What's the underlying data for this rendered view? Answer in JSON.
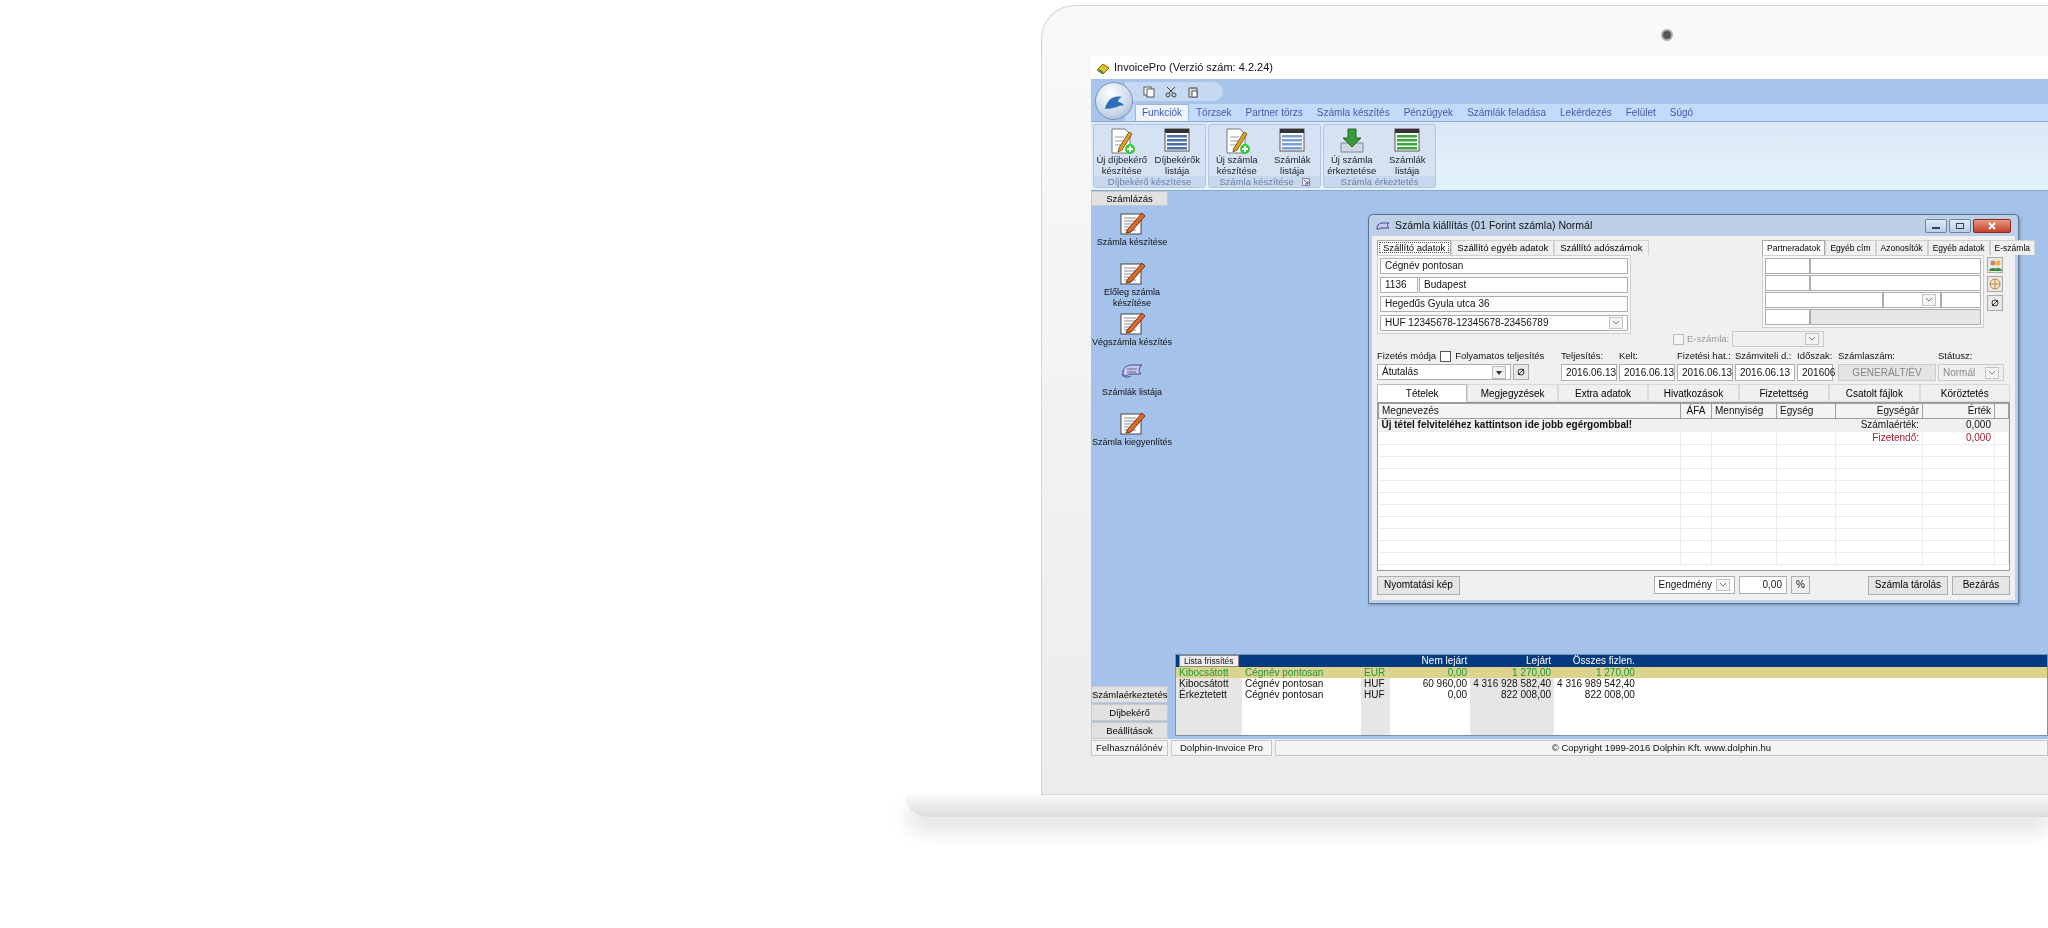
{
  "window": {
    "title": "InvoicePro (Verzió szám: 4.2.24)"
  },
  "ribbon": {
    "tabs": [
      {
        "label": "Funkciók",
        "selected": true
      },
      {
        "label": "Törzsek",
        "selected": false
      },
      {
        "label": "Partner törzs",
        "selected": false
      },
      {
        "label": "Számla készítés",
        "selected": false
      },
      {
        "label": "Pénzügyek",
        "selected": false
      },
      {
        "label": "Számlák feladása",
        "selected": false
      },
      {
        "label": "Lekérdezés",
        "selected": false
      },
      {
        "label": "Felület",
        "selected": false
      },
      {
        "label": "Súgó",
        "selected": false
      }
    ],
    "groups": [
      {
        "title": "Díjbekérő készítése",
        "launcher": false,
        "buttons": [
          {
            "label": "Új díjbekérő készítése",
            "kind": "new-document"
          },
          {
            "label": "Díjbekérők listája",
            "kind": "list"
          }
        ]
      },
      {
        "title": "Számla készítése",
        "launcher": true,
        "buttons": [
          {
            "label": "Új számla készítése",
            "kind": "new-document"
          },
          {
            "label": "Számlák listája",
            "kind": "list"
          }
        ]
      },
      {
        "title": "Számla érkeztetés",
        "launcher": false,
        "buttons": [
          {
            "label": "Új számla érkeztetése",
            "kind": "receive"
          },
          {
            "label": "Számlák listája",
            "kind": "list"
          }
        ]
      }
    ]
  },
  "sidebar": {
    "header": "Számlázás",
    "items": [
      {
        "label": "Számla készítése",
        "kind": "document"
      },
      {
        "label": "Előleg számla készítése",
        "kind": "document"
      },
      {
        "label": "Végszámla készítés",
        "kind": "document"
      },
      {
        "label": "Számlák listája",
        "kind": "list"
      },
      {
        "label": "Számla kiegyenlítés",
        "kind": "document"
      }
    ],
    "sections": [
      "Számlaérkeztetés",
      "Díjbekérő",
      "Beállítások"
    ]
  },
  "dialog": {
    "title": "Számla kiállítás (01 Forint számla) Normál",
    "supplier": {
      "tabs": [
        {
          "label": "Szállító adatok",
          "selected": true
        },
        {
          "label": "Szállító egyéb adatok",
          "selected": false
        },
        {
          "label": "Szállító adószámok",
          "selected": false
        }
      ],
      "company": "Cégnév pontosan",
      "zip": "1136",
      "city": "Budapest",
      "street": "Hegedűs Gyula utca 36",
      "bank_account": "HUF 12345678-12345678-23456789"
    },
    "partner_tabs": [
      {
        "label": "Partneradatok",
        "selected": true
      },
      {
        "label": "Egyéb cím",
        "selected": false
      },
      {
        "label": "Azonosítók",
        "selected": false
      },
      {
        "label": "Egyéb adatok",
        "selected": false
      },
      {
        "label": "E-számla",
        "selected": false
      }
    ],
    "e_invoice": {
      "label": "E-számla:",
      "checked": false,
      "disabled": true
    },
    "payment": {
      "label": "Fizetés módja",
      "value": "Átutalás",
      "continuous": {
        "label": "Folyamatos teljesítés",
        "checked": false
      }
    },
    "fields": [
      {
        "label": "Teljesítés:",
        "value": "2016.06.13",
        "kind": "text",
        "disabled": false
      },
      {
        "label": "Kelt:",
        "value": "2016.06.13",
        "kind": "text",
        "disabled": false
      },
      {
        "label": "Fizetési hat.:",
        "value": "2016.06.13",
        "kind": "text",
        "disabled": false
      },
      {
        "label": "Számviteli d.:",
        "value": "2016.06.13",
        "kind": "text",
        "disabled": false
      },
      {
        "label": "Időszak:",
        "value": "201606",
        "kind": "text",
        "disabled": false
      },
      {
        "label": "Számlaszám:",
        "value": "GENERÁLT/ÉV",
        "kind": "button",
        "disabled": true
      },
      {
        "label": "Státusz:",
        "value": "Normál",
        "kind": "select",
        "disabled": true
      }
    ],
    "item_tabs": [
      {
        "label": "Tételek",
        "selected": true
      },
      {
        "label": "Megjegyzések",
        "selected": false
      },
      {
        "label": "Extra adatok",
        "selected": false
      },
      {
        "label": "Hivatkozások",
        "selected": false
      },
      {
        "label": "Fizetettség",
        "selected": false
      },
      {
        "label": "Csatolt fájlok",
        "selected": false
      },
      {
        "label": "Köröztetés",
        "selected": false
      }
    ],
    "items_table": {
      "columns": [
        "Megnevezés",
        "ÁFA",
        "Mennyiség",
        "Egység",
        "Egységár",
        "Érték"
      ],
      "hint": "Új tétel felviteléhez kattintson ide jobb egérgombbal!",
      "totals": [
        {
          "label": "Számlaérték:",
          "value": "0,000",
          "kind": "total"
        },
        {
          "label": "Fizetendő:",
          "value": "0,000",
          "kind": "due"
        }
      ]
    },
    "print_button": "Nyomtatási kép",
    "discount": {
      "label": "Engedmény",
      "value": "0,00",
      "unit": "%"
    },
    "buttons": [
      "Számla tárolás",
      "Bezárás"
    ]
  },
  "summary_list": {
    "refresh_button": "Lista frissítés",
    "columns": [
      "",
      "",
      "",
      "Nem lejárt",
      "Lejárt",
      "Összes fizlen."
    ],
    "rows": [
      {
        "selected": true,
        "cells": [
          "Kibocsátott",
          "Cégnév pontosan",
          "EUR",
          "0,00",
          "1 270,00",
          "1 270,00"
        ]
      },
      {
        "selected": false,
        "cells": [
          "Kibocsátott",
          "Cégnév pontosan",
          "HUF",
          "60 960,00",
          "4 316 928 582,40",
          "4 316 989 542,40"
        ]
      },
      {
        "selected": false,
        "cells": [
          "Érkeztetett",
          "Cégnév pontosan",
          "HUF",
          "0,00",
          "822 008,00",
          "822 008,00"
        ]
      }
    ]
  },
  "status_bar": [
    "Felhasználónév",
    "Dolphin-Invoice Pro",
    "© Copyright 1999-2016 Dolphin Kft. www.dolphin.hu"
  ]
}
